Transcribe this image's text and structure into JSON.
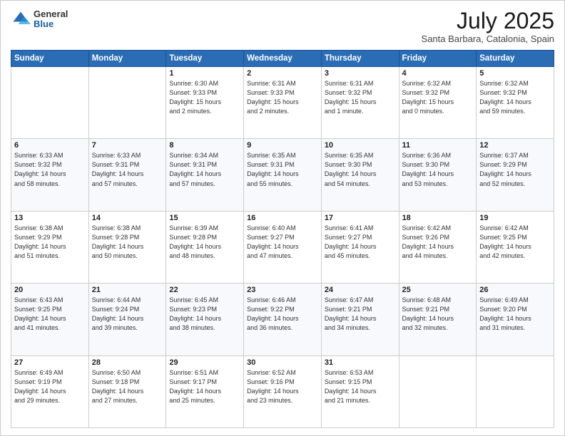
{
  "header": {
    "logo_general": "General",
    "logo_blue": "Blue",
    "month": "July 2025",
    "location": "Santa Barbara, Catalonia, Spain"
  },
  "days_of_week": [
    "Sunday",
    "Monday",
    "Tuesday",
    "Wednesday",
    "Thursday",
    "Friday",
    "Saturday"
  ],
  "weeks": [
    [
      {
        "day": "",
        "info": ""
      },
      {
        "day": "",
        "info": ""
      },
      {
        "day": "1",
        "info": "Sunrise: 6:30 AM\nSunset: 9:33 PM\nDaylight: 15 hours\nand 2 minutes."
      },
      {
        "day": "2",
        "info": "Sunrise: 6:31 AM\nSunset: 9:33 PM\nDaylight: 15 hours\nand 2 minutes."
      },
      {
        "day": "3",
        "info": "Sunrise: 6:31 AM\nSunset: 9:32 PM\nDaylight: 15 hours\nand 1 minute."
      },
      {
        "day": "4",
        "info": "Sunrise: 6:32 AM\nSunset: 9:32 PM\nDaylight: 15 hours\nand 0 minutes."
      },
      {
        "day": "5",
        "info": "Sunrise: 6:32 AM\nSunset: 9:32 PM\nDaylight: 14 hours\nand 59 minutes."
      }
    ],
    [
      {
        "day": "6",
        "info": "Sunrise: 6:33 AM\nSunset: 9:32 PM\nDaylight: 14 hours\nand 58 minutes."
      },
      {
        "day": "7",
        "info": "Sunrise: 6:33 AM\nSunset: 9:31 PM\nDaylight: 14 hours\nand 57 minutes."
      },
      {
        "day": "8",
        "info": "Sunrise: 6:34 AM\nSunset: 9:31 PM\nDaylight: 14 hours\nand 57 minutes."
      },
      {
        "day": "9",
        "info": "Sunrise: 6:35 AM\nSunset: 9:31 PM\nDaylight: 14 hours\nand 55 minutes."
      },
      {
        "day": "10",
        "info": "Sunrise: 6:35 AM\nSunset: 9:30 PM\nDaylight: 14 hours\nand 54 minutes."
      },
      {
        "day": "11",
        "info": "Sunrise: 6:36 AM\nSunset: 9:30 PM\nDaylight: 14 hours\nand 53 minutes."
      },
      {
        "day": "12",
        "info": "Sunrise: 6:37 AM\nSunset: 9:29 PM\nDaylight: 14 hours\nand 52 minutes."
      }
    ],
    [
      {
        "day": "13",
        "info": "Sunrise: 6:38 AM\nSunset: 9:29 PM\nDaylight: 14 hours\nand 51 minutes."
      },
      {
        "day": "14",
        "info": "Sunrise: 6:38 AM\nSunset: 9:28 PM\nDaylight: 14 hours\nand 50 minutes."
      },
      {
        "day": "15",
        "info": "Sunrise: 6:39 AM\nSunset: 9:28 PM\nDaylight: 14 hours\nand 48 minutes."
      },
      {
        "day": "16",
        "info": "Sunrise: 6:40 AM\nSunset: 9:27 PM\nDaylight: 14 hours\nand 47 minutes."
      },
      {
        "day": "17",
        "info": "Sunrise: 6:41 AM\nSunset: 9:27 PM\nDaylight: 14 hours\nand 45 minutes."
      },
      {
        "day": "18",
        "info": "Sunrise: 6:42 AM\nSunset: 9:26 PM\nDaylight: 14 hours\nand 44 minutes."
      },
      {
        "day": "19",
        "info": "Sunrise: 6:42 AM\nSunset: 9:25 PM\nDaylight: 14 hours\nand 42 minutes."
      }
    ],
    [
      {
        "day": "20",
        "info": "Sunrise: 6:43 AM\nSunset: 9:25 PM\nDaylight: 14 hours\nand 41 minutes."
      },
      {
        "day": "21",
        "info": "Sunrise: 6:44 AM\nSunset: 9:24 PM\nDaylight: 14 hours\nand 39 minutes."
      },
      {
        "day": "22",
        "info": "Sunrise: 6:45 AM\nSunset: 9:23 PM\nDaylight: 14 hours\nand 38 minutes."
      },
      {
        "day": "23",
        "info": "Sunrise: 6:46 AM\nSunset: 9:22 PM\nDaylight: 14 hours\nand 36 minutes."
      },
      {
        "day": "24",
        "info": "Sunrise: 6:47 AM\nSunset: 9:21 PM\nDaylight: 14 hours\nand 34 minutes."
      },
      {
        "day": "25",
        "info": "Sunrise: 6:48 AM\nSunset: 9:21 PM\nDaylight: 14 hours\nand 32 minutes."
      },
      {
        "day": "26",
        "info": "Sunrise: 6:49 AM\nSunset: 9:20 PM\nDaylight: 14 hours\nand 31 minutes."
      }
    ],
    [
      {
        "day": "27",
        "info": "Sunrise: 6:49 AM\nSunset: 9:19 PM\nDaylight: 14 hours\nand 29 minutes."
      },
      {
        "day": "28",
        "info": "Sunrise: 6:50 AM\nSunset: 9:18 PM\nDaylight: 14 hours\nand 27 minutes."
      },
      {
        "day": "29",
        "info": "Sunrise: 6:51 AM\nSunset: 9:17 PM\nDaylight: 14 hours\nand 25 minutes."
      },
      {
        "day": "30",
        "info": "Sunrise: 6:52 AM\nSunset: 9:16 PM\nDaylight: 14 hours\nand 23 minutes."
      },
      {
        "day": "31",
        "info": "Sunrise: 6:53 AM\nSunset: 9:15 PM\nDaylight: 14 hours\nand 21 minutes."
      },
      {
        "day": "",
        "info": ""
      },
      {
        "day": "",
        "info": ""
      }
    ]
  ]
}
